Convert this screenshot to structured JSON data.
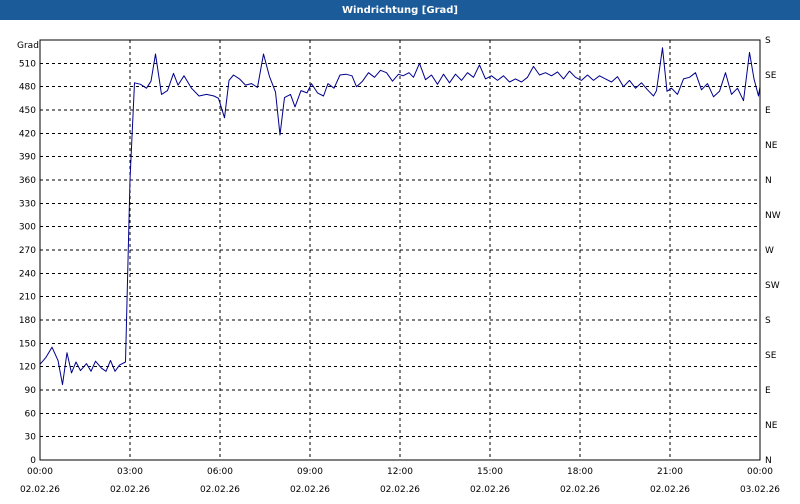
{
  "window": {
    "title": "Windrichtung [Grad]"
  },
  "colors": {
    "titlebar": "#1c5b99",
    "line": "#00008b",
    "grid": "#000000"
  },
  "chart_data": {
    "type": "line",
    "title": "Windrichtung [Grad]",
    "ylabel": "Grad",
    "ylim": [
      0,
      540
    ],
    "xlim_hours": [
      0,
      24
    ],
    "grid": true,
    "y_ticks": [
      0,
      30,
      60,
      90,
      120,
      150,
      180,
      210,
      240,
      270,
      300,
      330,
      360,
      390,
      420,
      450,
      480,
      510
    ],
    "x_ticks": [
      {
        "time": "00:00",
        "date": "02.02.26"
      },
      {
        "time": "03:00",
        "date": "02.02.26"
      },
      {
        "time": "06:00",
        "date": "02.02.26"
      },
      {
        "time": "09:00",
        "date": "02.02.26"
      },
      {
        "time": "12:00",
        "date": "02.02.26"
      },
      {
        "time": "15:00",
        "date": "02.02.26"
      },
      {
        "time": "18:00",
        "date": "02.02.26"
      },
      {
        "time": "21:00",
        "date": "02.02.26"
      },
      {
        "time": "00:00",
        "date": "03.02.26"
      }
    ],
    "right_axis": [
      {
        "label": "S",
        "value": 540
      },
      {
        "label": "SE",
        "value": 495
      },
      {
        "label": "E",
        "value": 450
      },
      {
        "label": "NE",
        "value": 405
      },
      {
        "label": "N",
        "value": 360
      },
      {
        "label": "NW",
        "value": 315
      },
      {
        "label": "W",
        "value": 270
      },
      {
        "label": "SW",
        "value": 225
      },
      {
        "label": "S",
        "value": 180
      },
      {
        "label": "SE",
        "value": 135
      },
      {
        "label": "E",
        "value": 90
      },
      {
        "label": "NE",
        "value": 45
      },
      {
        "label": "N",
        "value": 0
      }
    ],
    "series": [
      {
        "values": [
          [
            0.0,
            123
          ],
          [
            0.2,
            132
          ],
          [
            0.4,
            145
          ],
          [
            0.6,
            128
          ],
          [
            0.75,
            97
          ],
          [
            0.9,
            138
          ],
          [
            1.05,
            112
          ],
          [
            1.2,
            126
          ],
          [
            1.35,
            115
          ],
          [
            1.55,
            124
          ],
          [
            1.7,
            114
          ],
          [
            1.85,
            127
          ],
          [
            2.05,
            118
          ],
          [
            2.2,
            114
          ],
          [
            2.35,
            128
          ],
          [
            2.5,
            114
          ],
          [
            2.65,
            122
          ],
          [
            2.85,
            126
          ],
          [
            3.0,
            360
          ],
          [
            3.15,
            485
          ],
          [
            3.35,
            483
          ],
          [
            3.55,
            478
          ],
          [
            3.7,
            487
          ],
          [
            3.85,
            522
          ],
          [
            4.05,
            470
          ],
          [
            4.25,
            475
          ],
          [
            4.45,
            497
          ],
          [
            4.6,
            482
          ],
          [
            4.8,
            494
          ],
          [
            5.05,
            478
          ],
          [
            5.3,
            468
          ],
          [
            5.55,
            470
          ],
          [
            5.8,
            468
          ],
          [
            5.95,
            465
          ],
          [
            6.15,
            440
          ],
          [
            6.3,
            488
          ],
          [
            6.45,
            495
          ],
          [
            6.65,
            490
          ],
          [
            6.85,
            482
          ],
          [
            7.05,
            484
          ],
          [
            7.25,
            479
          ],
          [
            7.45,
            522
          ],
          [
            7.65,
            493
          ],
          [
            7.85,
            473
          ],
          [
            8.0,
            418
          ],
          [
            8.15,
            466
          ],
          [
            8.35,
            470
          ],
          [
            8.5,
            454
          ],
          [
            8.7,
            475
          ],
          [
            8.9,
            472
          ],
          [
            9.05,
            484
          ],
          [
            9.25,
            472
          ],
          [
            9.45,
            468
          ],
          [
            9.6,
            484
          ],
          [
            9.8,
            478
          ],
          [
            10.0,
            495
          ],
          [
            10.2,
            496
          ],
          [
            10.4,
            494
          ],
          [
            10.55,
            480
          ],
          [
            10.75,
            487
          ],
          [
            10.95,
            498
          ],
          [
            11.15,
            492
          ],
          [
            11.35,
            501
          ],
          [
            11.55,
            498
          ],
          [
            11.75,
            487
          ],
          [
            11.95,
            496
          ],
          [
            12.1,
            494
          ],
          [
            12.3,
            498
          ],
          [
            12.45,
            492
          ],
          [
            12.65,
            510
          ],
          [
            12.85,
            489
          ],
          [
            13.05,
            495
          ],
          [
            13.25,
            483
          ],
          [
            13.45,
            496
          ],
          [
            13.65,
            485
          ],
          [
            13.85,
            496
          ],
          [
            14.05,
            488
          ],
          [
            14.25,
            498
          ],
          [
            14.45,
            492
          ],
          [
            14.65,
            508
          ],
          [
            14.85,
            490
          ],
          [
            15.05,
            494
          ],
          [
            15.25,
            488
          ],
          [
            15.45,
            494
          ],
          [
            15.65,
            486
          ],
          [
            15.85,
            490
          ],
          [
            16.05,
            486
          ],
          [
            16.25,
            492
          ],
          [
            16.45,
            506
          ],
          [
            16.65,
            495
          ],
          [
            16.85,
            498
          ],
          [
            17.05,
            494
          ],
          [
            17.25,
            499
          ],
          [
            17.45,
            490
          ],
          [
            17.65,
            500
          ],
          [
            17.85,
            492
          ],
          [
            18.05,
            488
          ],
          [
            18.25,
            495
          ],
          [
            18.45,
            488
          ],
          [
            18.65,
            494
          ],
          [
            18.85,
            490
          ],
          [
            19.05,
            486
          ],
          [
            19.25,
            493
          ],
          [
            19.45,
            480
          ],
          [
            19.65,
            488
          ],
          [
            19.85,
            478
          ],
          [
            20.05,
            485
          ],
          [
            20.25,
            476
          ],
          [
            20.45,
            468
          ],
          [
            20.55,
            475
          ],
          [
            20.75,
            530
          ],
          [
            20.9,
            474
          ],
          [
            21.05,
            478
          ],
          [
            21.25,
            470
          ],
          [
            21.45,
            490
          ],
          [
            21.65,
            492
          ],
          [
            21.85,
            498
          ],
          [
            22.05,
            476
          ],
          [
            22.25,
            484
          ],
          [
            22.45,
            467
          ],
          [
            22.65,
            474
          ],
          [
            22.85,
            498
          ],
          [
            23.05,
            470
          ],
          [
            23.25,
            478
          ],
          [
            23.45,
            462
          ],
          [
            23.65,
            524
          ],
          [
            23.8,
            490
          ],
          [
            23.95,
            468
          ],
          [
            24.0,
            480
          ]
        ]
      }
    ]
  }
}
